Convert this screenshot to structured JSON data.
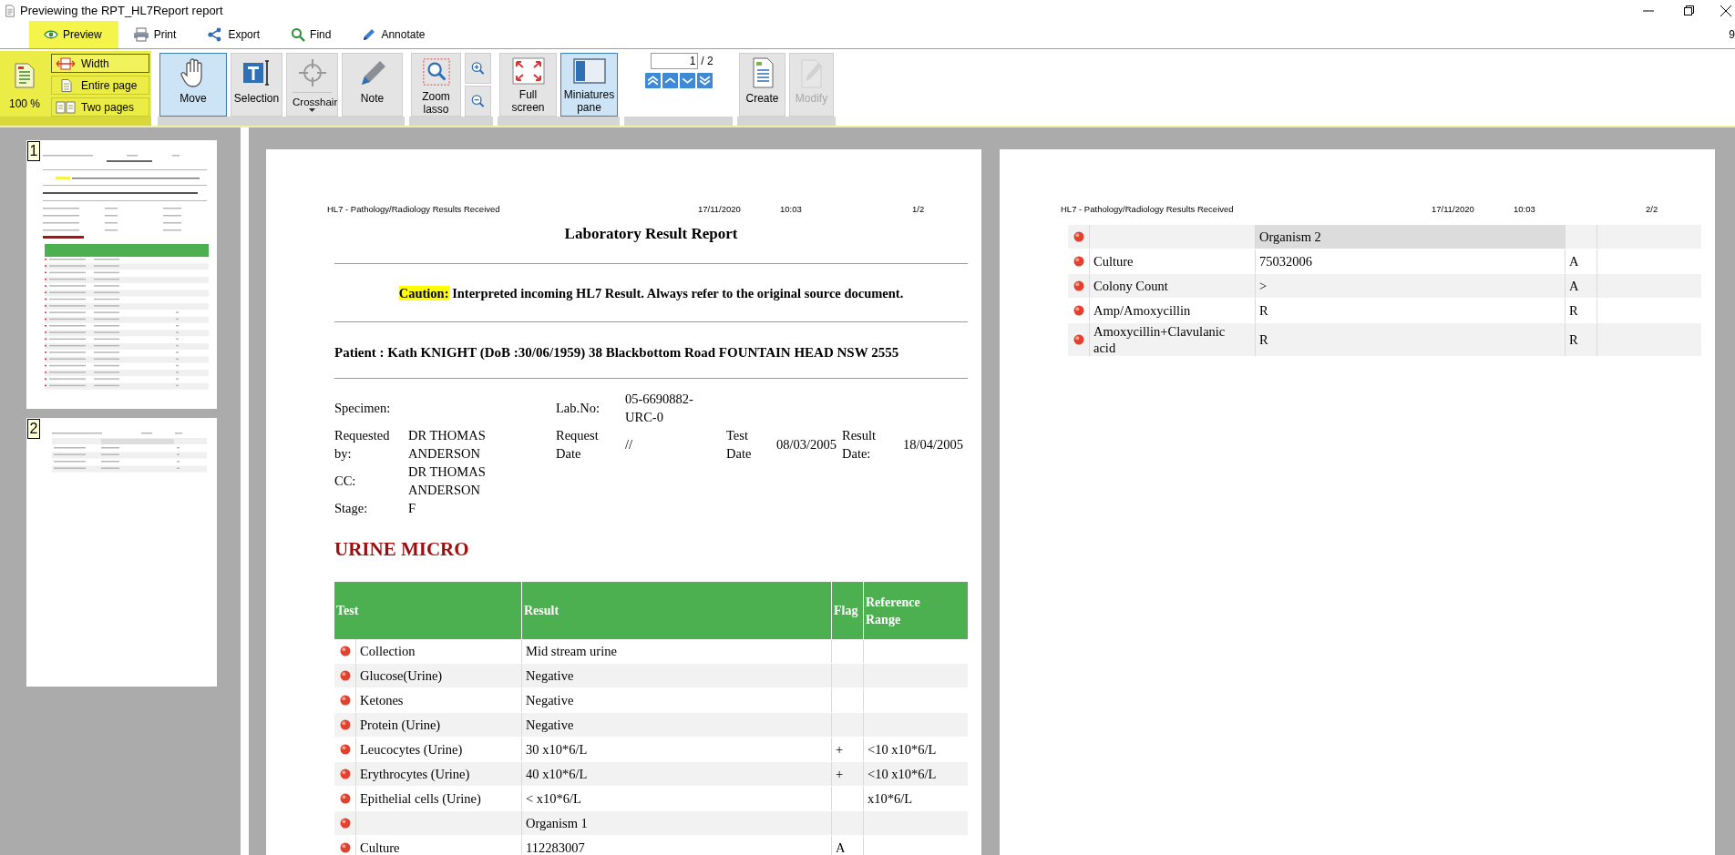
{
  "window": {
    "title": "Previewing the RPT_HL7Report report",
    "corner_text": "9"
  },
  "tabs": [
    {
      "label": "Preview",
      "selected": true
    },
    {
      "label": "Print",
      "selected": false
    },
    {
      "label": "Export",
      "selected": false
    },
    {
      "label": "Find",
      "selected": false
    },
    {
      "label": "Annotate",
      "selected": false
    }
  ],
  "ribbon": {
    "groups": [
      {
        "kind": "zoom",
        "zoom_button": "100 %",
        "fit_options": [
          {
            "label": "Width",
            "selected": true
          },
          {
            "label": "Entire page",
            "selected": false
          },
          {
            "label": "Two pages",
            "selected": false
          }
        ]
      },
      {
        "kind": "buttons",
        "items": [
          {
            "kind": "large",
            "label": "Move",
            "selected": true,
            "disabled": false
          },
          {
            "kind": "large",
            "label": "Selection",
            "selected": false,
            "disabled": false
          },
          {
            "kind": "dropdown",
            "label": "Crosshair",
            "selected": false,
            "disabled": false
          },
          {
            "kind": "large",
            "label": "Note",
            "selected": false,
            "disabled": false
          }
        ]
      },
      {
        "kind": "buttons",
        "items": [
          {
            "kind": "large",
            "label": "Zoom lasso",
            "selected": false,
            "disabled": false
          },
          {
            "kind": "icon",
            "selected": false,
            "disabled": false
          },
          {
            "kind": "icon",
            "selected": false,
            "disabled": false
          }
        ]
      },
      {
        "kind": "buttons",
        "items": [
          {
            "kind": "large",
            "label": "Full screen",
            "selected": false,
            "disabled": false
          },
          {
            "kind": "large",
            "label": "Miniatures pane",
            "selected": true,
            "disabled": false
          }
        ]
      },
      {
        "kind": "navigator",
        "page_input": "1",
        "page_total": "/ 2"
      },
      {
        "kind": "buttons",
        "items": [
          {
            "kind": "large",
            "label": "Create",
            "selected": false,
            "disabled": false
          },
          {
            "kind": "large",
            "label": "Modify",
            "selected": false,
            "disabled": true
          }
        ]
      }
    ]
  },
  "miniatures": [
    {
      "number": "1"
    },
    {
      "number": "2"
    }
  ],
  "pages": [
    {
      "header": {
        "source": "HL7 - Pathology/Radiology Results Received",
        "date": "17/11/2020",
        "time": "10:03",
        "page": "1/2"
      },
      "title": "Laboratory Result Report",
      "caution": {
        "label": "Caution:",
        "text": "Interpreted incoming HL7 Result. Always refer to the original source document."
      },
      "patient": "Patient : Kath KNIGHT (DoB :30/06/1959) 38 Blackbottom Road FOUNTAIN HEAD NSW 2555",
      "details": {
        "specimen_label": "Specimen:",
        "lab_no_label": "Lab.No:",
        "lab_no": "05-6690882-URC-0",
        "requested_by_label": "Requested by:",
        "requested_by": "DR THOMAS ANDERSON",
        "request_date_label": "Request Date",
        "request_date": "//",
        "test_date_label": "Test Date",
        "test_date": "08/03/2005",
        "result_date_label": "Result Date:",
        "result_date": "18/04/2005",
        "cc_label": "CC:",
        "cc": "DR THOMAS ANDERSON",
        "stage_label": "Stage:",
        "stage": "F"
      },
      "section": "URINE MICRO",
      "table": {
        "columns": [
          "Test",
          "Result",
          "Flag",
          "Reference Range"
        ],
        "rows": [
          {
            "test": "Collection",
            "result": "Mid stream urine",
            "highlighted": false
          },
          {
            "test": "Glucose(Urine)",
            "result": "Negative",
            "highlighted": false
          },
          {
            "test": "Ketones",
            "result": "Negative",
            "highlighted": false
          },
          {
            "test": "Protein (Urine)",
            "result": "Negative",
            "highlighted": false
          },
          {
            "test": "Leucocytes (Urine)",
            "result": "30 x10*6/L",
            "flag": "+",
            "reference_range": "<10 x10*6/L",
            "highlighted": false
          },
          {
            "test": "Erythrocytes (Urine)",
            "result": "40 x10*6/L",
            "flag": "+",
            "reference_range": "<10 x10*6/L",
            "highlighted": false
          },
          {
            "test": "Epithelial cells (Urine)",
            "result": "< x10*6/L",
            "reference_range": "x10*6/L",
            "highlighted": false
          },
          {
            "result": "Organism 1",
            "highlighted": false
          },
          {
            "test": "Culture",
            "result": "112283007",
            "flag": "A",
            "highlighted": false
          }
        ]
      }
    },
    {
      "header": {
        "source": "HL7 - Pathology/Radiology Results Received",
        "date": "17/11/2020",
        "time": "10:03",
        "page": "2/2"
      },
      "table": {
        "rows": [
          {
            "result": "Organism 2",
            "highlighted": true
          },
          {
            "test": "Culture",
            "result": "75032006",
            "flag": "A",
            "highlighted": false
          },
          {
            "test": "Colony Count",
            "result": ">",
            "flag": "A",
            "highlighted": false
          },
          {
            "test": "Amp/Amoxycillin",
            "result": "R",
            "flag": "R",
            "highlighted": false
          },
          {
            "test": "Amoxycillin+Clavulanic acid",
            "result": "R",
            "flag": "R",
            "highlighted": false
          }
        ]
      }
    }
  ]
}
